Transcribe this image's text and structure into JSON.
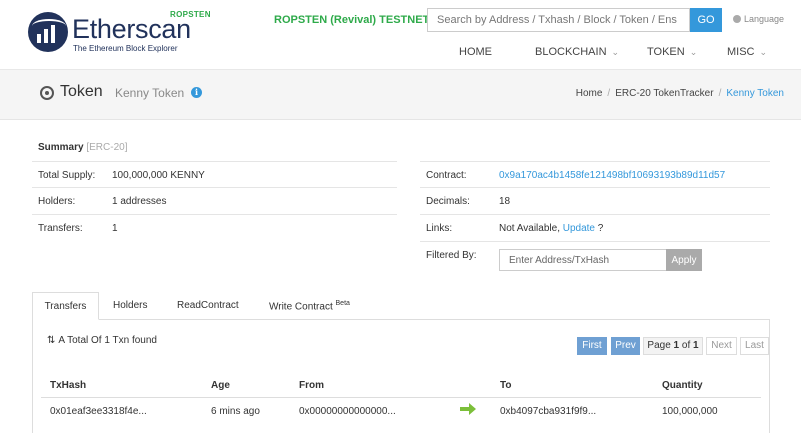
{
  "brand": {
    "name": "Etherscan",
    "tagline": "The Ethereum Block Explorer",
    "network_badge": "ROPSTEN"
  },
  "header": {
    "testnet_label": "ROPSTEN (Revival) TESTNET",
    "search_placeholder": "Search by Address / Txhash / Block / Token / Ens",
    "go_label": "GO",
    "language_label": "Language",
    "nav": [
      {
        "label": "HOME"
      },
      {
        "label": "BLOCKCHAIN"
      },
      {
        "label": "TOKEN"
      },
      {
        "label": "MISC"
      }
    ]
  },
  "title": {
    "main": "Token",
    "sub": "Kenny Token",
    "info_icon": "i",
    "breadcrumb": [
      "Home",
      "ERC-20 TokenTracker",
      "Kenny Token"
    ]
  },
  "summary": {
    "heading": "Summary",
    "standard": "[ERC-20]",
    "left": [
      {
        "label": "Total Supply:",
        "value": "100,000,000 KENNY"
      },
      {
        "label": "Holders:",
        "value": "1 addresses"
      },
      {
        "label": "Transfers:",
        "value": "1"
      }
    ],
    "right": {
      "contract_label": "Contract:",
      "contract_value": "0x9a170ac4b1458fe121498bf10693193b89d11d57",
      "decimals_label": "Decimals:",
      "decimals_value": "18",
      "links_label": "Links:",
      "links_text": "Not Available,",
      "links_update": "Update",
      "links_suffix": "?",
      "filter_label": "Filtered By:",
      "filter_placeholder": "Enter Address/TxHash",
      "apply_label": "Apply"
    }
  },
  "tabs": [
    {
      "label": "Transfers",
      "active": true
    },
    {
      "label": "Holders"
    },
    {
      "label": "ReadContract"
    },
    {
      "label": "Write Contract",
      "sup": "Beta"
    }
  ],
  "transfers": {
    "total_text": "A Total Of 1 Txn found",
    "pagination": {
      "first": "First",
      "prev": "Prev",
      "page_prefix": "Page",
      "page_current": "1",
      "page_of": "of",
      "page_total": "1",
      "next": "Next",
      "last": "Last"
    },
    "columns": [
      "TxHash",
      "Age",
      "From",
      "To",
      "Quantity"
    ],
    "rows": [
      {
        "txhash": "0x01eaf3ee3318f4e...",
        "age": "6 mins ago",
        "from": "0x00000000000000...",
        "to": "0xb4097cba931f9f9...",
        "quantity": "100,000,000"
      }
    ]
  },
  "colors": {
    "accent": "#3498db",
    "brand_navy": "#21325b",
    "testnet_green": "#2eaa4a"
  }
}
